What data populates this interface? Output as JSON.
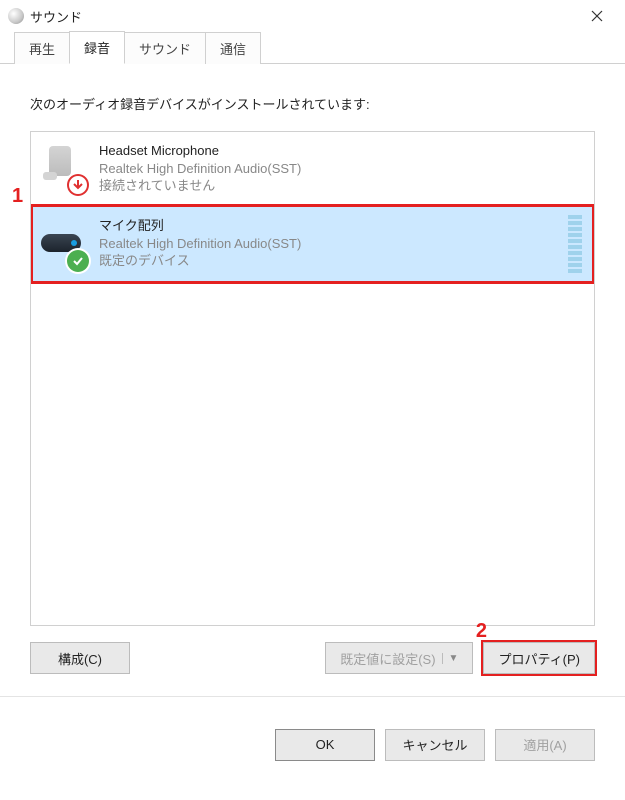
{
  "window": {
    "title": "サウンド"
  },
  "tabs": [
    {
      "label": "再生"
    },
    {
      "label": "録音"
    },
    {
      "label": "サウンド"
    },
    {
      "label": "通信"
    }
  ],
  "active_tab_index": 1,
  "instruction": "次のオーディオ録音デバイスがインストールされています:",
  "devices": [
    {
      "name": "Headset Microphone",
      "driver": "Realtek High Definition Audio(SST)",
      "status": "接続されていません",
      "status_icon": "disconnected",
      "selected": false
    },
    {
      "name": "マイク配列",
      "driver": "Realtek High Definition Audio(SST)",
      "status": "既定のデバイス",
      "status_icon": "default",
      "selected": true
    }
  ],
  "annotations": {
    "marker1": "1",
    "marker2": "2"
  },
  "buttons": {
    "configure": "構成(C)",
    "set_default": "既定値に設定(S)",
    "properties": "プロパティ(P)",
    "ok": "OK",
    "cancel": "キャンセル",
    "apply": "適用(A)"
  }
}
